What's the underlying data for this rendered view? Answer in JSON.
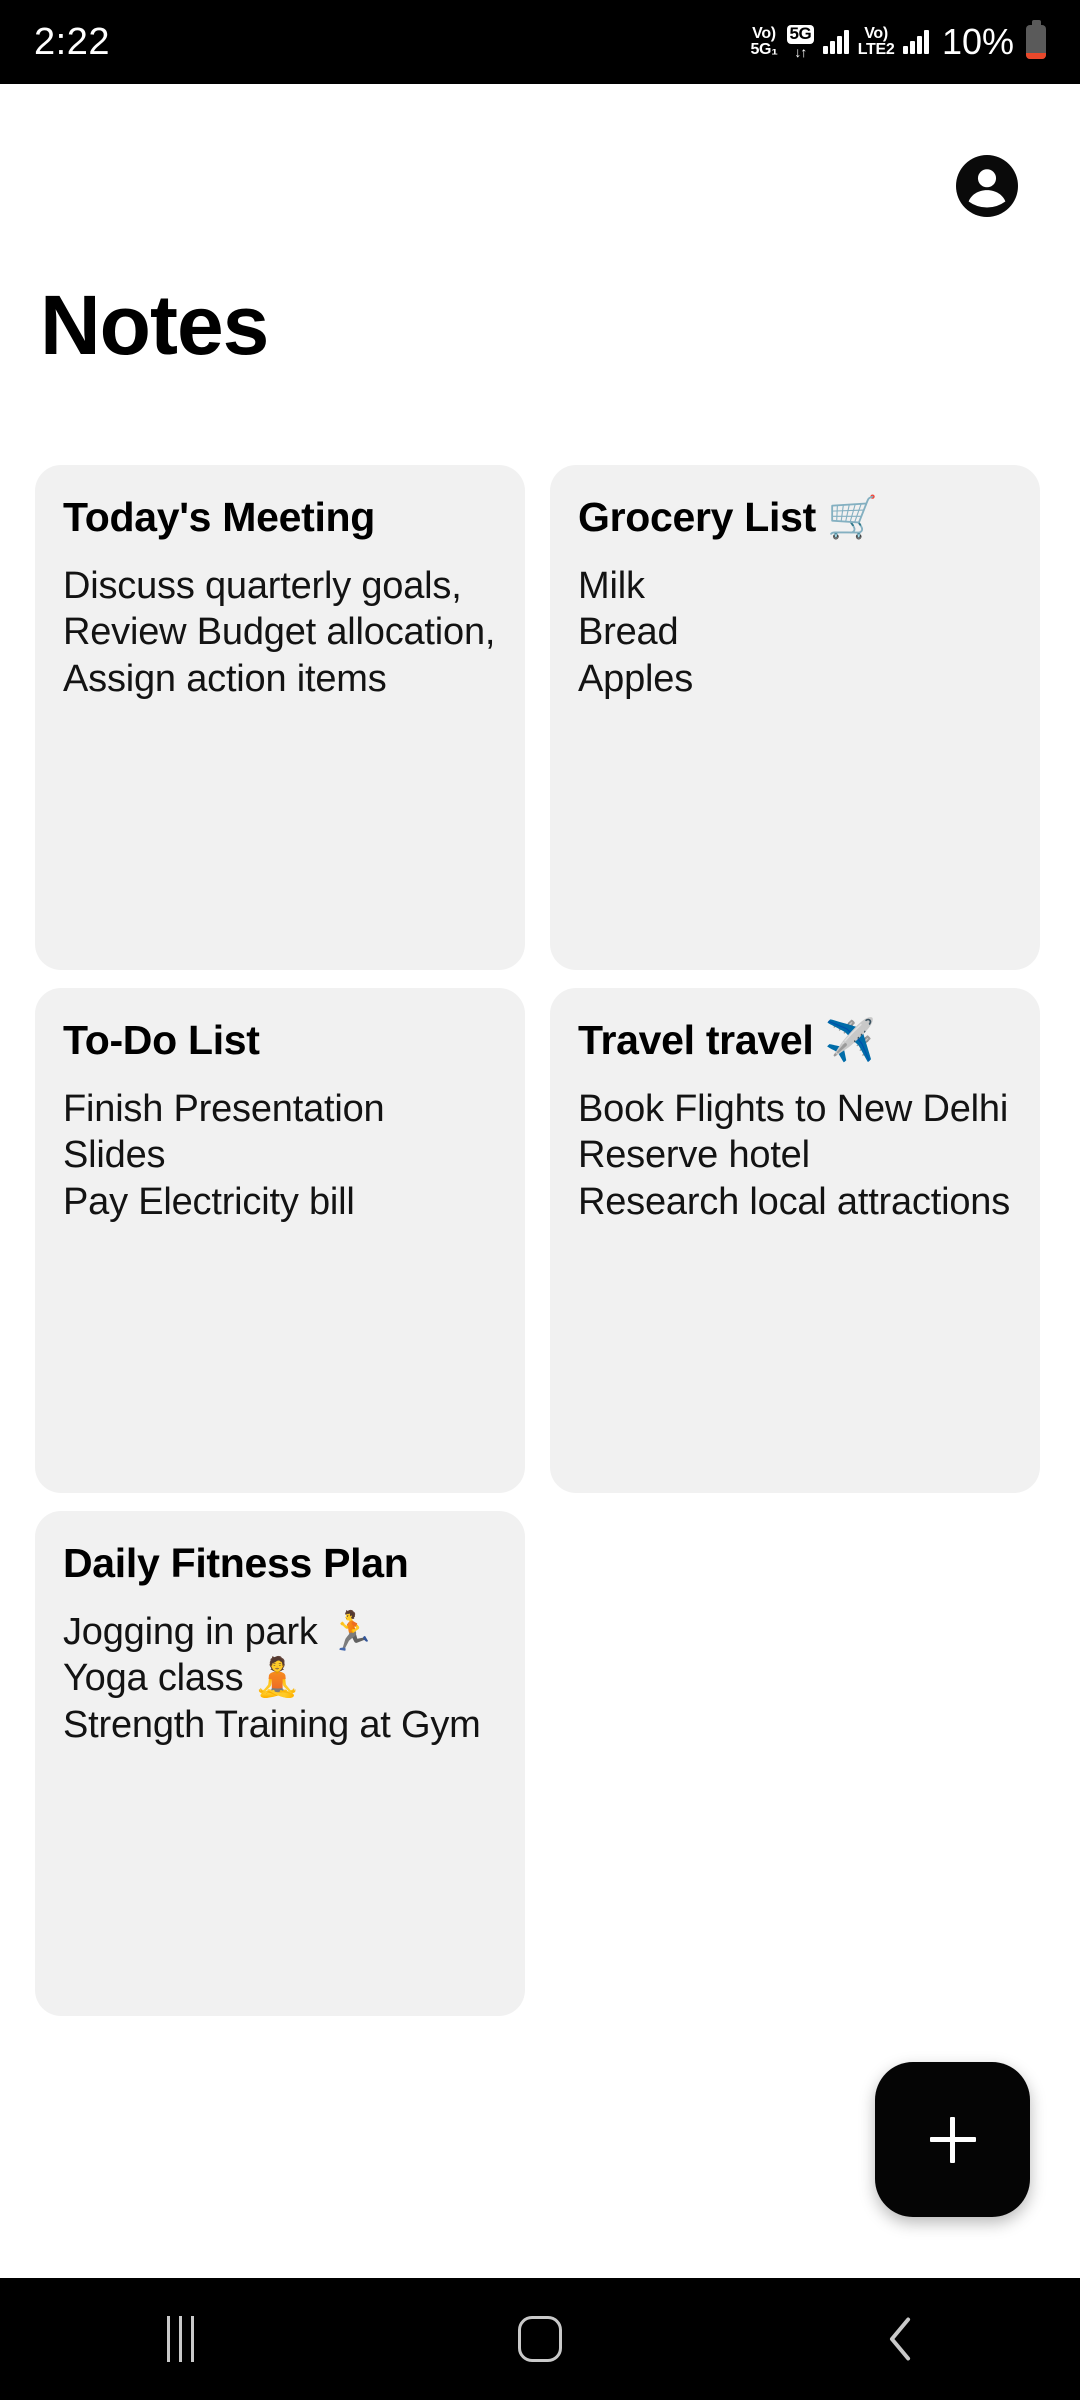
{
  "status_bar": {
    "time": "2:22",
    "volte_left": {
      "vo": "Vo)",
      "network": "5G₁"
    },
    "five_g_badge": "5G",
    "data_arrows": "↓↑",
    "volte_right": {
      "vo": "Vo)",
      "network": "LTE2"
    },
    "battery_percent": "10%",
    "colors": {
      "background": "#000000",
      "text": "#ffffff",
      "battery_low": "#e8482b"
    }
  },
  "header": {
    "title": "Notes",
    "avatar_icon": "account-circle-icon"
  },
  "notes": [
    {
      "title": "Today's Meeting",
      "emoji": "",
      "body": "Discuss quarterly goals,\nReview Budget allocation,\nAssign action items"
    },
    {
      "title": "Grocery List",
      "emoji": "🛒",
      "body": "Milk\nBread\nApples"
    },
    {
      "title": "To-Do List",
      "emoji": "",
      "body": "Finish Presentation Slides\nPay Electricity bill"
    },
    {
      "title": "Travel travel",
      "emoji": "✈️",
      "body": "Book Flights to New Delhi\nReserve hotel\nResearch local attractions"
    },
    {
      "title": "Daily Fitness Plan",
      "emoji": "",
      "body": "Jogging in park 🏃\nYoga class 🧘\nStrength Training at Gym"
    }
  ],
  "fab": {
    "label": "+",
    "icon": "plus-icon",
    "background": "#050505"
  },
  "nav_bar": {
    "recents_label": "Recents",
    "home_label": "Home",
    "back_label": "Back",
    "background": "#000000"
  },
  "theme": {
    "page_background": "#ffffff",
    "card_background": "#f1f1f1",
    "text_primary": "#000000"
  }
}
